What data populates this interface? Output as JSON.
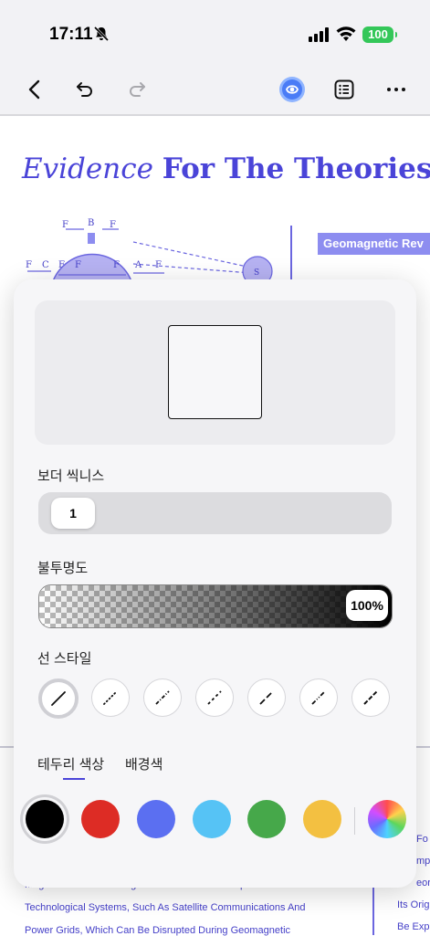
{
  "status": {
    "time": "17:11",
    "battery": "100"
  },
  "toolbar": {
    "back": "back-icon",
    "undo": "undo-icon",
    "redo": "redo-icon",
    "ai": "ai-assistant-icon",
    "list": "list-icon",
    "more": "more-icon"
  },
  "document": {
    "title_italic": "Evidence",
    "title_bold": "For The Theories",
    "section_header": "Geomagnetic Rev",
    "diagram_labels": [
      "F",
      "B",
      "F",
      "F",
      "C",
      "F",
      "F",
      "F",
      "A",
      "F",
      "S"
    ],
    "bottom_lines": [
      "Magnetic Field For Navigation. It Also Has An Impact On Modern",
      "Technological Systems, Such As Satellite Communications And",
      "Power Grids, Which Can Be Disrupted During Geomagnetic"
    ],
    "right_lines": [
      "Fo",
      "mple",
      "eory",
      "Its Orig",
      "Be Exp"
    ]
  },
  "panel": {
    "border_thickness_label": "보더 씩니스",
    "border_thickness_value": "1",
    "opacity_label": "불투명도",
    "opacity_value": "100%",
    "line_style_label": "선 스타일",
    "line_styles": [
      "solid",
      "dotted",
      "dash-dot",
      "dashed",
      "long-dash",
      "dash-dot-dot",
      "dense-dash"
    ],
    "selected_line_style": "solid",
    "tabs": [
      "테두리 색상",
      "배경색"
    ],
    "selected_tab": "테두리 색상",
    "colors": [
      "#000000",
      "#dd2c25",
      "#5b6ff1",
      "#56c3f5",
      "#46a84a",
      "#f3c041"
    ],
    "selected_color": "#000000"
  },
  "accent": "#4a44d8"
}
